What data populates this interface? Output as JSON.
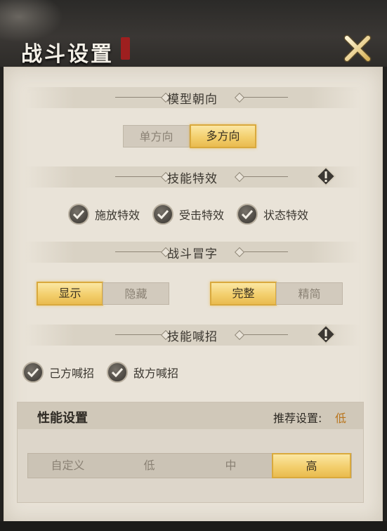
{
  "window": {
    "title": "战斗设置"
  },
  "sections": {
    "model_orientation": {
      "title": "模型朝向",
      "options": [
        "单方向",
        "多方向"
      ],
      "selected": "多方向"
    },
    "skill_effects": {
      "title": "技能特效",
      "checks": [
        "施放特效",
        "受击特效",
        "状态特效"
      ],
      "checked": [
        true,
        true,
        true
      ],
      "info_icon": "warning-diamond-icon"
    },
    "damage_numbers": {
      "title": "战斗冒字",
      "visibility_options": [
        "显示",
        "隐藏"
      ],
      "visibility_selected": "显示",
      "detail_options": [
        "完整",
        "精简"
      ],
      "detail_selected": "完整"
    },
    "skill_shout": {
      "title": "技能喊招",
      "checks": [
        "己方喊招",
        "敌方喊招"
      ],
      "checked": [
        true,
        true
      ],
      "info_icon": "warning-diamond-icon"
    }
  },
  "performance": {
    "title": "性能设置",
    "recommend_label": "推荐设置:",
    "recommend_value": "低",
    "quality_options": [
      "自定义",
      "低",
      "中",
      "高"
    ],
    "quality_selected": "高"
  },
  "colors": {
    "accent_gold": "#f3cf6d",
    "recommend_text": "#b9751d",
    "panel_bg": "#e9e3d8"
  }
}
